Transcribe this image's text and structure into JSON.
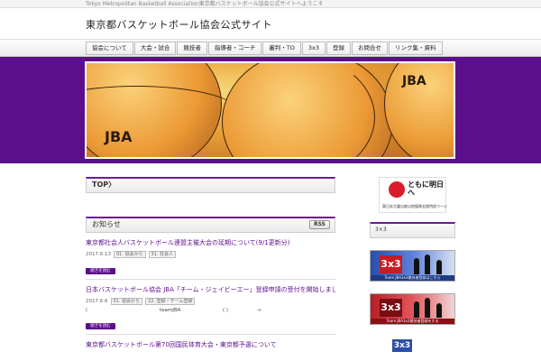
{
  "topbar": {
    "tagline": "Tokyo Metropolitan Basketball Association東京都バスケットボール協会公式サイトへようこそ"
  },
  "site": {
    "title": "東京都バスケットボール協会公式サイト"
  },
  "nav": {
    "items": [
      "協会について",
      "大会・試合",
      "競技者",
      "指導者・コーチ",
      "審判・TO",
      "3x3",
      "登録",
      "お問合せ",
      "リンク集・資料"
    ]
  },
  "hero": {
    "logo_text": "JBA",
    "accent_color": "#5c0f8b"
  },
  "breadcrumb": {
    "label": "TOP〉"
  },
  "news": {
    "heading": "お知らせ",
    "rss_label": "RSS",
    "posts": [
      {
        "title": "東京都社会人バスケットボール連盟主催大会の延期について(9/1更新分)",
        "date": "2017.6.13",
        "tags": [
          "01. 協会から",
          "31. 社会人"
        ],
        "excerpt_left": "",
        "excerpt_mid": "",
        "excerpt_right": "",
        "more": "続きを読む"
      },
      {
        "title": "日本バスケットボール協会 JBA「チーム・ジェイビーエー」登録申請の受付を開始しました",
        "date": "2017.6.6",
        "tags": [
          "01. 協会から",
          "22. 登録・チーム登録"
        ],
        "excerpt_left": "(",
        "excerpt_mid": "teamJBA",
        "excerpt_right": "( )",
        "excerpt_arrow": "→",
        "more": "続きを読む"
      },
      {
        "title": "東京都バスケットボール第70回国民体育大会・東京都予選について"
      }
    ]
  },
  "sidebar": {
    "banner1": {
      "title": "ともに明日へ",
      "caption": "東日本大震災被災地復興支援特設ページ"
    },
    "box_label": "3×3",
    "banner_3x3_a": {
      "logo": "3x3",
      "caption": "Team JBA3x3競技者登録はこちら"
    },
    "banner_3x3_b": {
      "logo": "3x3",
      "caption": "Team JBA3x3競技者登録をする"
    },
    "banner_3x3_c": {
      "logo": "3x3"
    }
  }
}
